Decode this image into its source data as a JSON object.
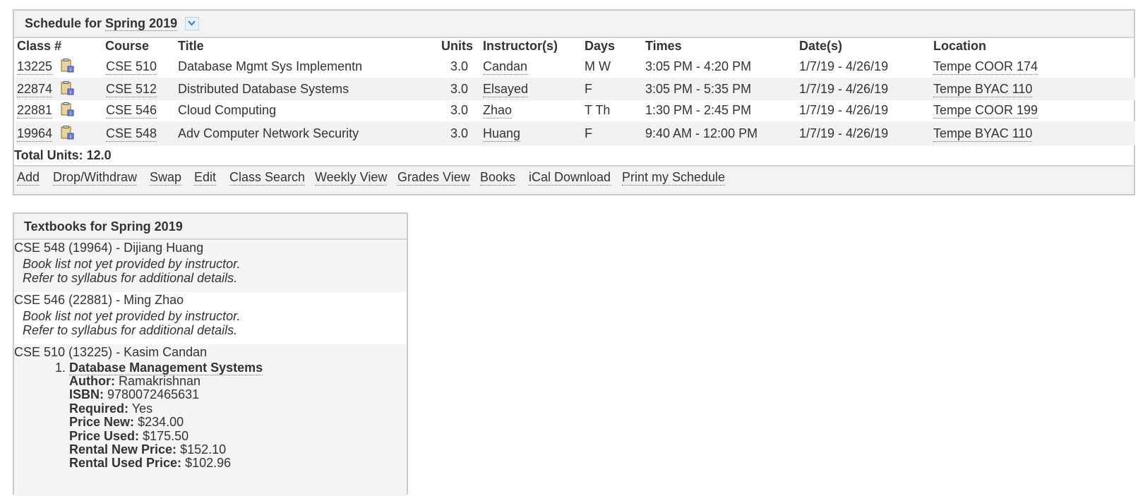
{
  "schedule": {
    "title_prefix": "Schedule for",
    "term": "Spring 2019",
    "columns": {
      "class_num": "Class #",
      "course": "Course",
      "title": "Title",
      "units": "Units",
      "instructors": "Instructor(s)",
      "days": "Days",
      "times": "Times",
      "dates": "Date(s)",
      "location": "Location"
    },
    "rows": [
      {
        "class_num": "13225",
        "course": "CSE 510",
        "title": "Database Mgmt Sys Implementn",
        "units": "3.0",
        "instructor": "Candan",
        "days": "M W",
        "times": "3:05 PM - 4:20 PM",
        "dates": "1/7/19 - 4/26/19",
        "location": "Tempe COOR 174"
      },
      {
        "class_num": "22874",
        "course": "CSE 512",
        "title": "Distributed Database Systems",
        "units": "3.0",
        "instructor": "Elsayed",
        "days": "F",
        "times": "3:05 PM - 5:35 PM",
        "dates": "1/7/19 - 4/26/19",
        "location": "Tempe BYAC 110"
      },
      {
        "class_num": "22881",
        "course": "CSE 546",
        "title": "Cloud Computing",
        "units": "3.0",
        "instructor": "Zhao",
        "days": "T Th",
        "times": "1:30 PM - 2:45 PM",
        "dates": "1/7/19 - 4/26/19",
        "location": "Tempe COOR 199"
      },
      {
        "class_num": "19964",
        "course": "CSE 548",
        "title": "Adv Computer Network Security",
        "units": "3.0",
        "instructor": "Huang",
        "days": "F",
        "times": "9:40 AM - 12:00 PM",
        "dates": "1/7/19 - 4/26/19",
        "location": "Tempe BYAC 110"
      }
    ],
    "total_units": "Total Units: 12.0",
    "actions": [
      "Add",
      "Drop/Withdraw",
      "Swap",
      "Edit",
      "Class Search",
      "Weekly View",
      "Grades View",
      "Books",
      "iCal Download",
      "Print my Schedule"
    ]
  },
  "textbooks": {
    "title": "Textbooks for Spring 2019",
    "sections": [
      {
        "heading": "CSE 548 (19964) - Dijiang Huang",
        "note1": "Book list not yet provided by instructor.",
        "note2": "Refer to syllabus for additional details."
      },
      {
        "heading": "CSE 546 (22881) - Ming Zhao",
        "note1": "Book list not yet provided by instructor.",
        "note2": "Refer to syllabus for additional details."
      },
      {
        "heading": "CSE 510 (13225) - Kasim Candan"
      }
    ],
    "book": {
      "number": "1.",
      "title": "Database Management Systems",
      "author_label": "Author:",
      "author": "Ramakrishnan",
      "isbn_label": "ISBN:",
      "isbn": "9780072465631",
      "required_label": "Required:",
      "required": "Yes",
      "price_new_label": "Price New:",
      "price_new": "$234.00",
      "price_used_label": "Price Used:",
      "price_used": "$175.50",
      "rental_new_label": "Rental New Price:",
      "rental_new": "$152.10",
      "rental_used_label": "Rental Used Price:",
      "rental_used": "$102.96"
    }
  }
}
